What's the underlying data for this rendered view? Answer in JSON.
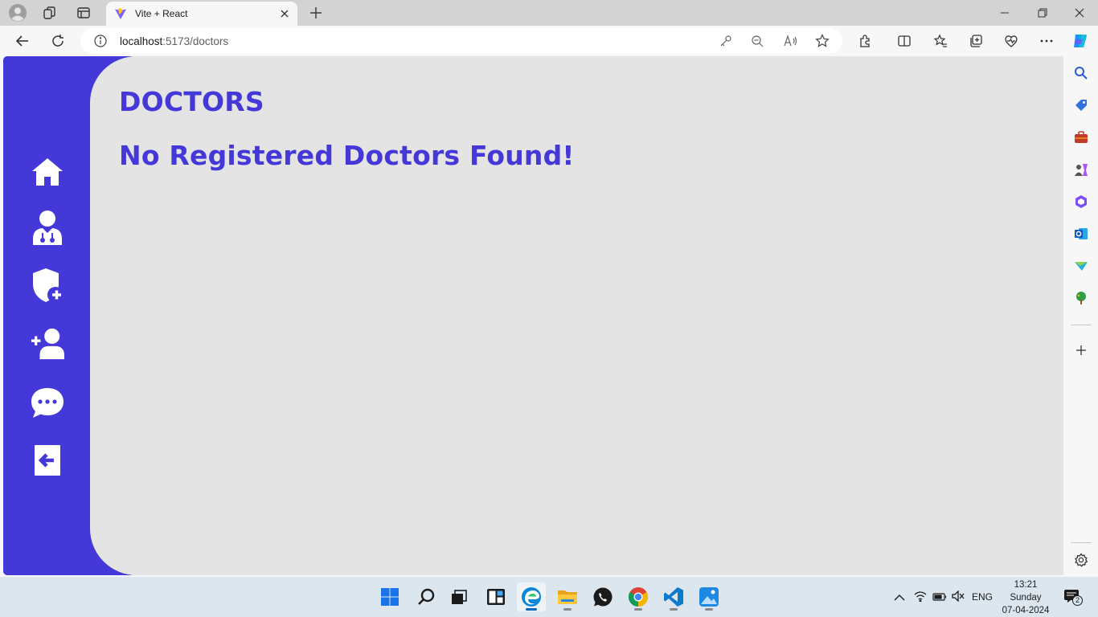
{
  "browser": {
    "tab_title": "Vite + React",
    "url_host": "localhost",
    "url_path": ":5173/doctors"
  },
  "page": {
    "title": "DOCTORS",
    "empty_message": "No Registered Doctors Found!"
  },
  "sidebar": {
    "items": [
      {
        "name": "home",
        "icon": "home-icon"
      },
      {
        "name": "doctors",
        "icon": "doctor-icon"
      },
      {
        "name": "add-admin",
        "icon": "shield-plus-icon"
      },
      {
        "name": "add-doctor",
        "icon": "user-plus-icon"
      },
      {
        "name": "messages",
        "icon": "chat-icon"
      },
      {
        "name": "logout",
        "icon": "logout-icon"
      }
    ]
  },
  "taskbar": {
    "language": "ENG",
    "time": "13:21",
    "day": "Sunday",
    "date": "07-04-2024",
    "notification_count": "2"
  },
  "colors": {
    "primary": "#4438d8",
    "page_bg": "#e4e4e4",
    "icon": "#ffffff"
  }
}
